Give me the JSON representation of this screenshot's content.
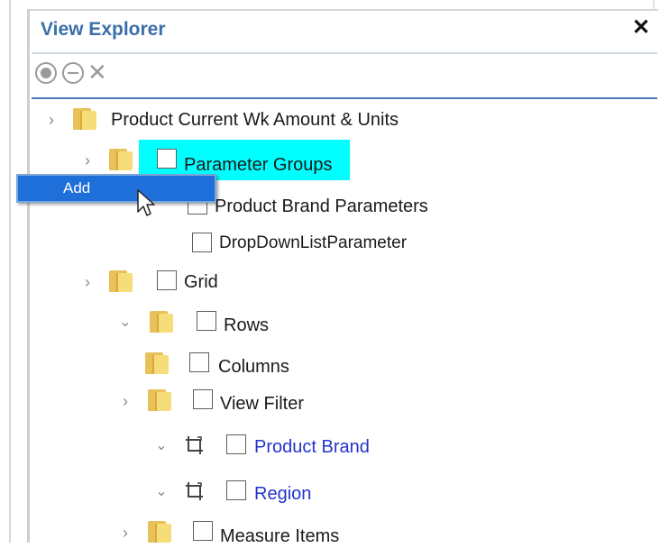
{
  "panel": {
    "title": "View Explorer",
    "close_icon": "close-icon"
  },
  "toolbar": {
    "icons": [
      "radio-selected-icon",
      "minus-circle-icon",
      "clear-x-icon"
    ]
  },
  "tree": {
    "root": "Product Current Wk Amount & Units",
    "parameter_groups": "Parameter Groups",
    "product_brand_parameters": "Product Brand Parameters",
    "dropdown_list_parameter": "DropDownListParameter",
    "grid": "Grid",
    "rows": "Rows",
    "columns": "Columns",
    "view_filter": "View Filter",
    "product_brand": "Product Brand",
    "region": "Region",
    "measure_items": "Measure Items"
  },
  "context_menu": {
    "add": "Add"
  },
  "colors": {
    "title": "#3a6fa8",
    "highlight": "#00ffff",
    "menu": "#1e6fd9",
    "link": "#2233cc"
  }
}
